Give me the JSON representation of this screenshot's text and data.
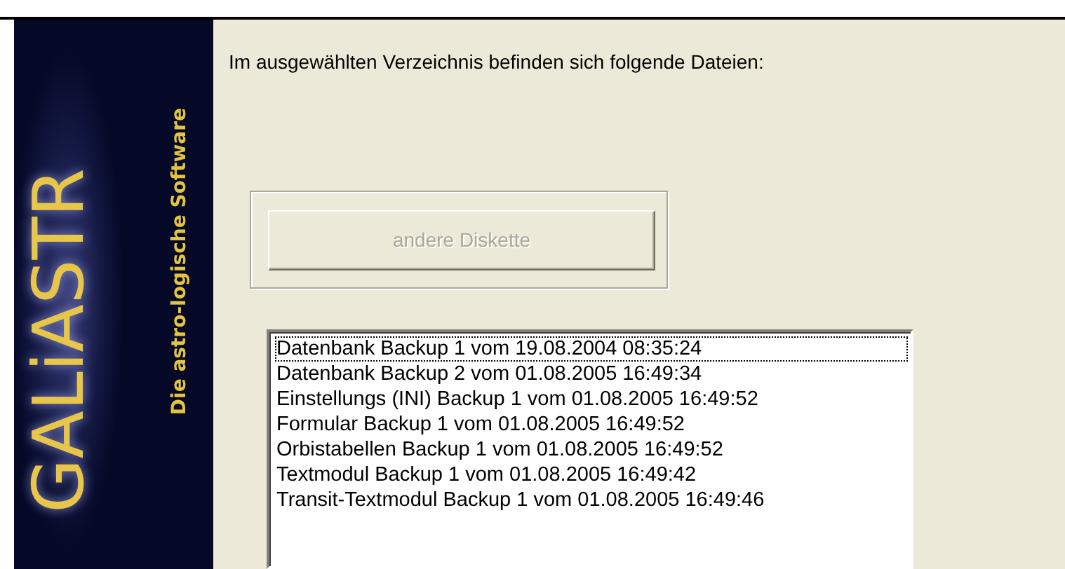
{
  "sidebar": {
    "logo": "GALiASTR",
    "tagline": "Die astro-logische Software"
  },
  "heading": "Im ausgewählten Verzeichnis befinden sich folgende Dateien:",
  "button": {
    "label": "andere Diskette",
    "disabled": true
  },
  "files": [
    {
      "label": "Datenbank Backup 1 vom 19.08.2004 08:35:24",
      "focused": true
    },
    {
      "label": "Datenbank Backup 2 vom 01.08.2005 16:49:34",
      "focused": false
    },
    {
      "label": "Einstellungs (INI) Backup 1 vom 01.08.2005 16:49:52",
      "focused": false
    },
    {
      "label": "Formular Backup 1 vom 01.08.2005 16:49:52",
      "focused": false
    },
    {
      "label": "Orbistabellen Backup 1 vom 01.08.2005 16:49:52",
      "focused": false
    },
    {
      "label": "Textmodul Backup 1 vom 01.08.2005 16:49:42",
      "focused": false
    },
    {
      "label": "Transit-Textmodul Backup 1 vom 01.08.2005 16:49:46",
      "focused": false
    }
  ]
}
